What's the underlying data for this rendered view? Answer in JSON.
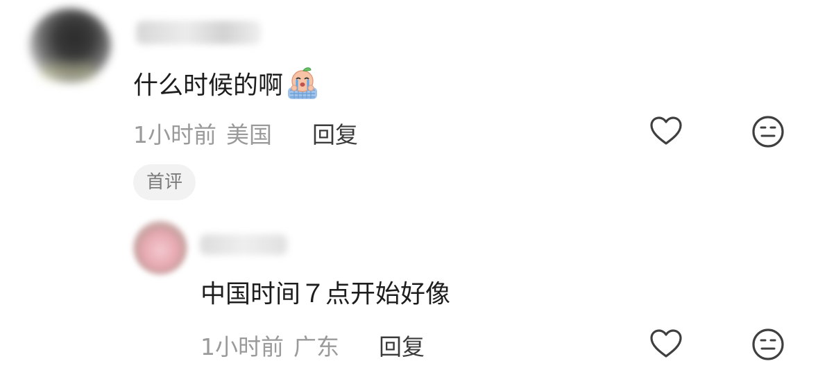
{
  "comments": [
    {
      "text": "什么时候的啊",
      "emoji_icon": "crying-peach-emoji-icon",
      "meta": {
        "time": "1小时前",
        "location": "美国",
        "reply_label": "回复"
      },
      "badge": "首评"
    },
    {
      "text": "中国时间７点开始好像",
      "meta": {
        "time": "1小时前",
        "location": "广东",
        "reply_label": "回复"
      }
    }
  ],
  "icons": {
    "like": "heart-outline-icon",
    "dislike": "meh-face-icon"
  },
  "colors": {
    "text_primary": "#1d1d1d",
    "text_meta": "#9a9a9a",
    "reply": "#3b3b3b",
    "badge_bg": "#f2f2f2",
    "badge_text": "#7a7a7a",
    "icon": "#3f3f3f"
  }
}
